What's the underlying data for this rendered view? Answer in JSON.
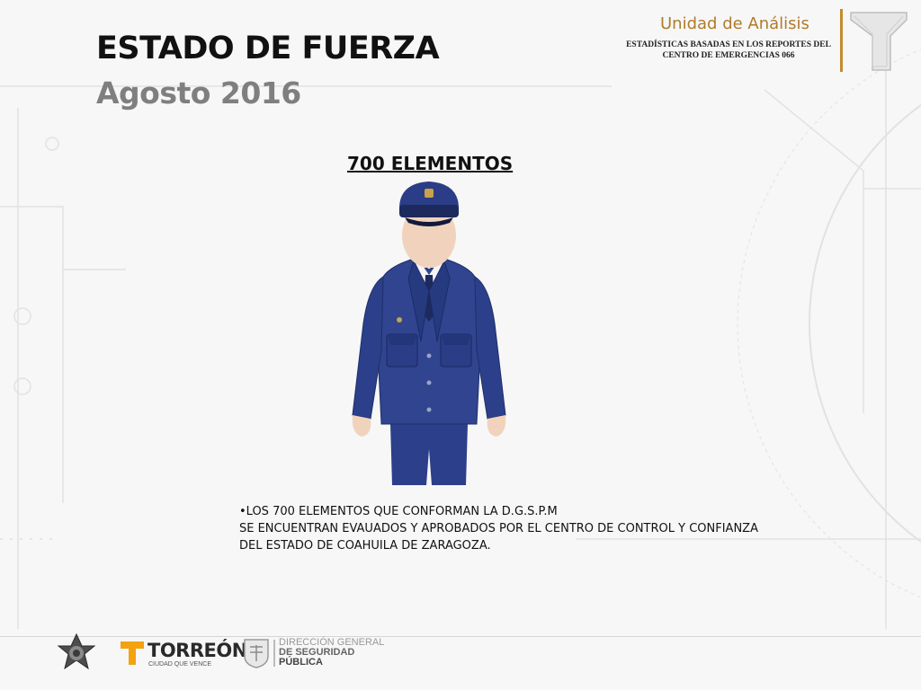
{
  "header": {
    "title": "ESTADO DE FUERZA",
    "subtitle": "Agosto 2016"
  },
  "unit": {
    "title": "Unidad de Análisis",
    "subtitle_lines": [
      "ESTADÍSTICAS BASADAS EN LOS REPORTES DEL",
      "CENTRO DE EMERGENCIAS 066"
    ]
  },
  "main": {
    "count_label": "700  ELEMENTOS",
    "note_lines": [
      "•LOS 700 ELEMENTOS QUE CONFORMAN LA D.G.S.P.M",
      "SE ENCUENTRAN EVAUADOS Y APROBADOS POR EL CENTRO DE CONTROL Y CONFIANZA",
      "DEL ESTADO DE COAHUILA DE ZARAGOZA."
    ]
  },
  "footer": {
    "torreon_name": "TORREÓN",
    "torreon_slogan": "CIUDAD QUE VENCE",
    "dgsp_lines": [
      "DIRECCIÓN GENERAL",
      "DE SEGURIDAD",
      "PÚBLICA"
    ]
  },
  "colors": {
    "accent": "#c48a2e",
    "uniform": "#2c3f8a",
    "subtitle": "#7f7f7f"
  }
}
